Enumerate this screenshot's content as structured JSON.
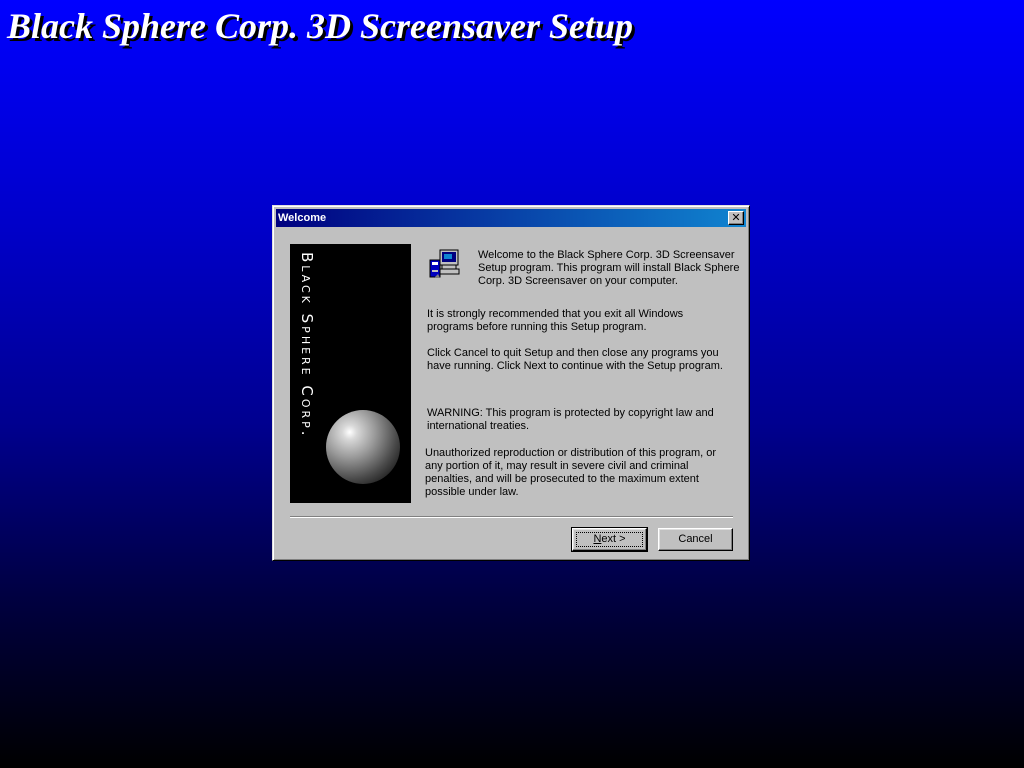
{
  "screen": {
    "title": "Black Sphere Corp. 3D Screensaver Setup"
  },
  "dialog": {
    "title": "Welcome",
    "close_glyph": "✕",
    "brand_text": "Black Sphere Corp.",
    "icon": "setup-computer-icon",
    "intro": "Welcome to the Black Sphere Corp. 3D Screensaver Setup program.  This program will install Black Sphere Corp. 3D Screensaver on your computer.",
    "recommend": "It is strongly recommended that you exit all Windows programs before running this Setup program.",
    "cancel_info": "Click Cancel to quit Setup and then close any programs you have running.  Click Next to continue with the Setup program.",
    "warning": "WARNING: This program is protected by copyright law and international treaties.",
    "unauthorized": "Unauthorized reproduction or distribution of this program, or any portion of it, may result in severe civil and criminal penalties, and will be prosecuted to the maximum extent possible under law.",
    "buttons": {
      "next_mnemonic": "N",
      "next_rest": "ext >",
      "cancel": "Cancel"
    }
  },
  "colors": {
    "background_top": "#0000ff",
    "background_bottom": "#000000",
    "titlebar_start": "#000080",
    "titlebar_end": "#1084d0",
    "dialog_face": "#c0c0c0"
  }
}
